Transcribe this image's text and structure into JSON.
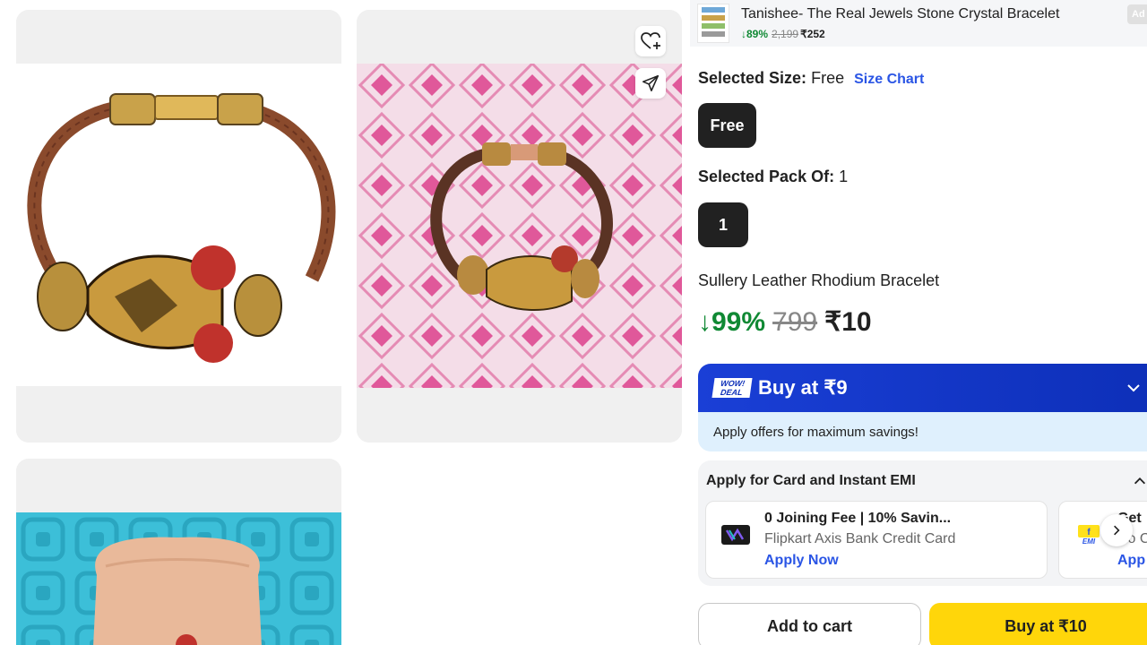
{
  "sticky_bar": {
    "title": "Tanishee- The Real Jewels Stone Crystal Bracelet",
    "discount": "↓89%",
    "mrp": "2,199",
    "price": "₹252",
    "ad_label": "Ad"
  },
  "size": {
    "label": "Selected Size:",
    "value": "Free",
    "chart_link": "Size Chart",
    "chip": "Free"
  },
  "pack": {
    "label": "Selected Pack Of:",
    "value": "1",
    "chip": "1"
  },
  "product": {
    "name": "Sullery Leather Rhodium Bracelet",
    "discount": "↓99%",
    "mrp": "799",
    "price": "₹10"
  },
  "wow_deal": {
    "logo_top": "WOW!",
    "logo_bottom": "DEAL",
    "title": "Buy at ₹9",
    "subtitle": "Apply offers for maximum savings!"
  },
  "emi": {
    "title": "Apply for Card and Instant EMI",
    "offers": [
      {
        "headline": "0 Joining Fee | 10% Savin...",
        "subtitle": "Flipkart Axis Bank Credit Card",
        "link": "Apply Now"
      },
      {
        "headline": "Get",
        "subtitle": "No C",
        "link": "App"
      }
    ]
  },
  "actions": {
    "add_to_cart": "Add to cart",
    "buy": "Buy at ₹10"
  },
  "icons": {
    "wishlist": "heart-plus-icon",
    "share": "share-arrow-icon",
    "expand": "chevron-down-icon",
    "collapse": "chevron-up-icon",
    "next": "chevron-right-icon"
  },
  "colors": {
    "green": "#108934",
    "link_blue": "#2a55e5",
    "wow_blue": "#1a3fd6",
    "buy_yellow": "#ffd60a",
    "chip_dark": "#212121"
  }
}
